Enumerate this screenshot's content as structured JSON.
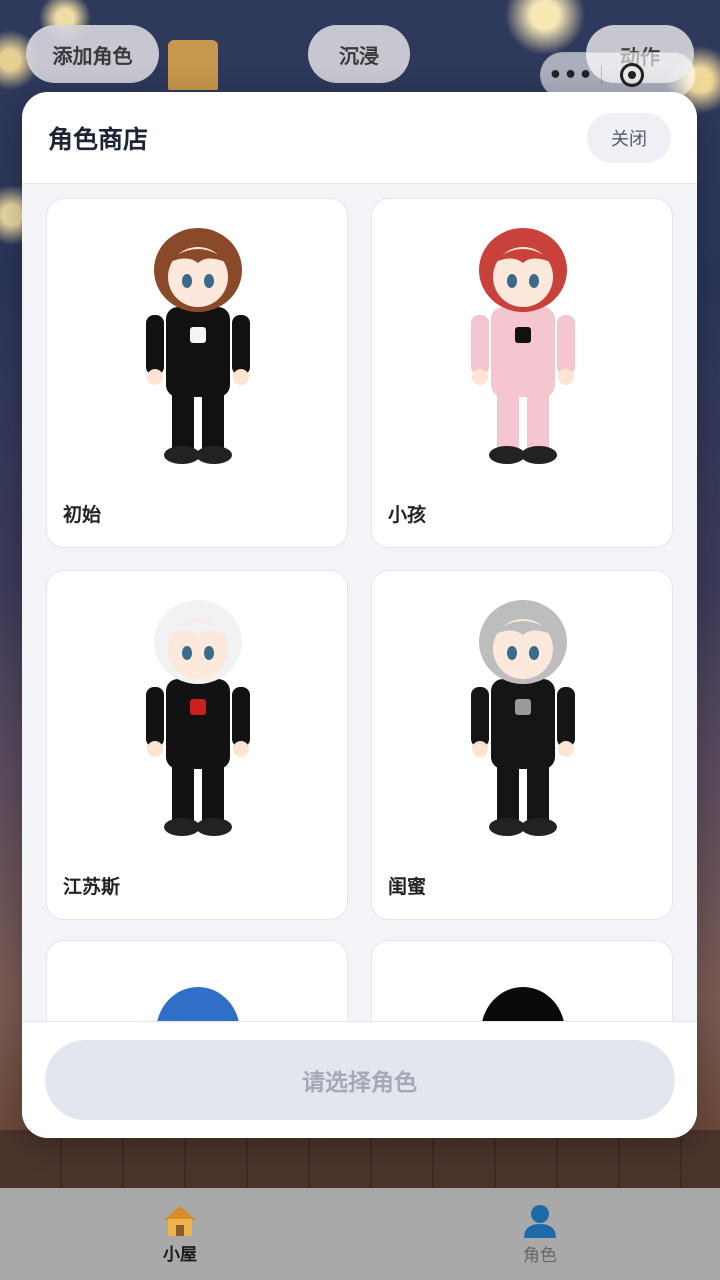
{
  "top_buttons": {
    "add_character": "添加角色",
    "immerse": "沉浸",
    "action": "动作"
  },
  "capsule": {
    "more": "•••"
  },
  "modal": {
    "title": "角色商店",
    "close_label": "关闭",
    "characters": [
      {
        "name": "初始",
        "hair": "#8a4a2a",
        "outfit": "#111111",
        "accent": "#f5f5f5"
      },
      {
        "name": "小孩",
        "hair": "#c8413b",
        "outfit": "#f4c6cf",
        "accent": "#111111"
      },
      {
        "name": "江苏斯",
        "hair": "#f2f2f2",
        "outfit": "#121212",
        "accent": "#cc1f1f"
      },
      {
        "name": "闺蜜",
        "hair": "#bdbdbd",
        "outfit": "#151515",
        "accent": "#9a9a9a"
      },
      {
        "name": "",
        "hair": "#2f6fc8"
      },
      {
        "name": "",
        "hair": "#0a0a0a"
      }
    ],
    "confirm_label": "请选择角色"
  },
  "tabbar": {
    "tabs": [
      {
        "label": "小屋",
        "icon": "house-icon",
        "active": true
      },
      {
        "label": "角色",
        "icon": "person-icon",
        "active": false
      }
    ],
    "active_color": "#1a1a1a",
    "person_icon_color": "#1e6aa8"
  }
}
